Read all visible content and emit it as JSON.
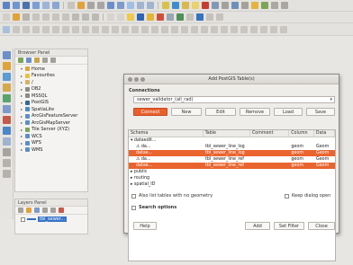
{
  "colors": {
    "accent": "#e95f2c",
    "selection": "#e9642f",
    "window_bg": "#e8e6e3"
  },
  "browser_panel": {
    "title": "Browser Panel",
    "tree": [
      {
        "label": "Home",
        "icon": "home-icon",
        "expanded": true
      },
      {
        "label": "Favourites",
        "icon": "star-icon",
        "expanded": false
      },
      {
        "label": "/",
        "icon": "folder-icon",
        "expanded": false
      },
      {
        "label": "DB2",
        "icon": "database-icon",
        "expanded": false
      },
      {
        "label": "MSSQL",
        "icon": "database-icon",
        "expanded": false
      },
      {
        "label": "PostGIS",
        "icon": "elephant-icon",
        "expanded": true
      },
      {
        "label": "SpatiaLite",
        "icon": "feather-icon",
        "expanded": false
      },
      {
        "label": "ArcGisFeatureServer",
        "icon": "globe-icon",
        "expanded": false
      },
      {
        "label": "ArcGisMapServer",
        "icon": "globe-icon",
        "expanded": false
      },
      {
        "label": "Tile Server (XYZ)",
        "icon": "grid-icon",
        "expanded": false
      },
      {
        "label": "WCS",
        "icon": "globe-icon",
        "expanded": false
      },
      {
        "label": "WFS",
        "icon": "globe-icon",
        "expanded": false
      },
      {
        "label": "WMS",
        "icon": "globe-icon",
        "expanded": false
      }
    ]
  },
  "layers_panel": {
    "title": "Layers Panel",
    "layers": [
      {
        "label": "tbl_sewer..."
      }
    ]
  },
  "dialog": {
    "title": "Add PostGIS Table(s)",
    "connections_label": "Connections",
    "connection_value": "sewer_validator_(all_rad)",
    "buttons": {
      "connect": "Connect",
      "new": "New",
      "edit": "Edit",
      "remove": "Remove",
      "load": "Load",
      "save": "Save",
      "help": "Help",
      "add": "Add",
      "set_filter": "Set Filter",
      "close": "Close"
    },
    "columns": [
      "Schema",
      "Table",
      "Comment",
      "Column",
      "Data"
    ],
    "rows": [
      {
        "schema": "▾ dataedit...",
        "table": "",
        "comment": "",
        "column": "",
        "data": "",
        "selected": false,
        "indent": 0
      },
      {
        "schema": "⚠ da...",
        "table": "tbl_sewer_line_log",
        "comment": "",
        "column": "geom",
        "data": "Geom",
        "selected": false,
        "indent": 1
      },
      {
        "schema": "datae...",
        "table": "tbl_sewer_line_log",
        "comment": "",
        "column": "geom",
        "data": "Geom",
        "selected": true,
        "indent": 1
      },
      {
        "schema": "⚠ da...",
        "table": "tbl_sewer_line_ref",
        "comment": "",
        "column": "geom",
        "data": "Geom",
        "selected": false,
        "indent": 1
      },
      {
        "schema": "datae...",
        "table": "tbl_sewer_line_ref",
        "comment": "",
        "column": "geom",
        "data": "Geom",
        "selected": true,
        "indent": 1
      },
      {
        "schema": "▸ public",
        "table": "",
        "comment": "",
        "column": "",
        "data": "",
        "selected": false,
        "indent": 0
      },
      {
        "schema": "▸ routing",
        "table": "",
        "comment": "",
        "column": "",
        "data": "",
        "selected": false,
        "indent": 0
      },
      {
        "schema": "▸ spatial_ID",
        "table": "",
        "comment": "",
        "column": "",
        "data": "",
        "selected": false,
        "indent": 0
      }
    ],
    "also_list_label": "Also list tables with no geometry",
    "keep_open_label": "Keep dialog open",
    "search_options_label": "Search options"
  }
}
